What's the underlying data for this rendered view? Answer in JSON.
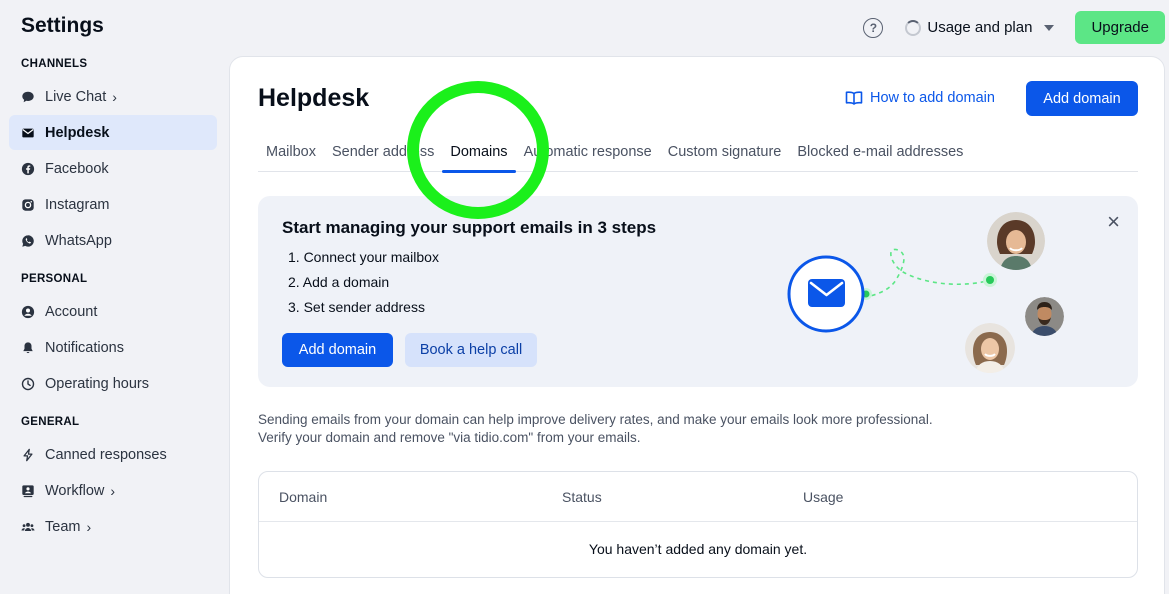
{
  "app": {
    "title": "Settings"
  },
  "topbar": {
    "help_icon": "question-circle-icon",
    "usage_label": "Usage and plan",
    "upgrade_label": "Upgrade"
  },
  "sidebar": {
    "sections": [
      {
        "title": "CHANNELS"
      },
      {
        "title": "PERSONAL"
      },
      {
        "title": "GENERAL"
      }
    ],
    "channels": [
      {
        "label": "Live Chat",
        "icon": "chat-bubble-icon",
        "chevron": "›"
      },
      {
        "label": "Helpdesk",
        "icon": "envelope-icon",
        "active": true
      },
      {
        "label": "Facebook",
        "icon": "facebook-icon"
      },
      {
        "label": "Instagram",
        "icon": "instagram-icon"
      },
      {
        "label": "WhatsApp",
        "icon": "whatsapp-icon"
      }
    ],
    "personal": [
      {
        "label": "Account",
        "icon": "user-icon"
      },
      {
        "label": "Notifications",
        "icon": "bell-icon"
      },
      {
        "label": "Operating hours",
        "icon": "clock-icon"
      }
    ],
    "general": [
      {
        "label": "Canned responses",
        "icon": "lightning-icon"
      },
      {
        "label": "Workflow",
        "icon": "workflow-icon",
        "chevron": "›"
      },
      {
        "label": "Team",
        "icon": "team-icon",
        "chevron": "›"
      }
    ]
  },
  "main": {
    "title": "Helpdesk",
    "howto_label": "How to add domain",
    "add_domain_label": "Add domain",
    "tabs": [
      {
        "label": "Mailbox"
      },
      {
        "label": "Sender address"
      },
      {
        "label": "Domains",
        "active": true
      },
      {
        "label": "Automatic response"
      },
      {
        "label": "Custom signature"
      },
      {
        "label": "Blocked e-mail addresses"
      }
    ],
    "card": {
      "title": "Start managing your support emails in 3 steps",
      "steps": [
        "1. Connect your mailbox",
        "2. Add a domain",
        "3. Set sender address"
      ],
      "primary_label": "Add domain",
      "secondary_label": "Book a help call",
      "close_glyph": "×"
    },
    "description": [
      "Sending emails from your domain can help improve delivery rates, and make your emails look more professional.",
      "Verify your domain and remove \"via tidio.com\" from your emails."
    ],
    "table": {
      "columns": [
        "Domain",
        "Status",
        "Usage"
      ],
      "empty_text": "You haven’t added any domain yet."
    }
  },
  "colors": {
    "accent": "#0b57e9",
    "upgrade": "#5ce686",
    "highlight_ring": "#1bf01b",
    "active_nav": "#dfe8fb"
  }
}
